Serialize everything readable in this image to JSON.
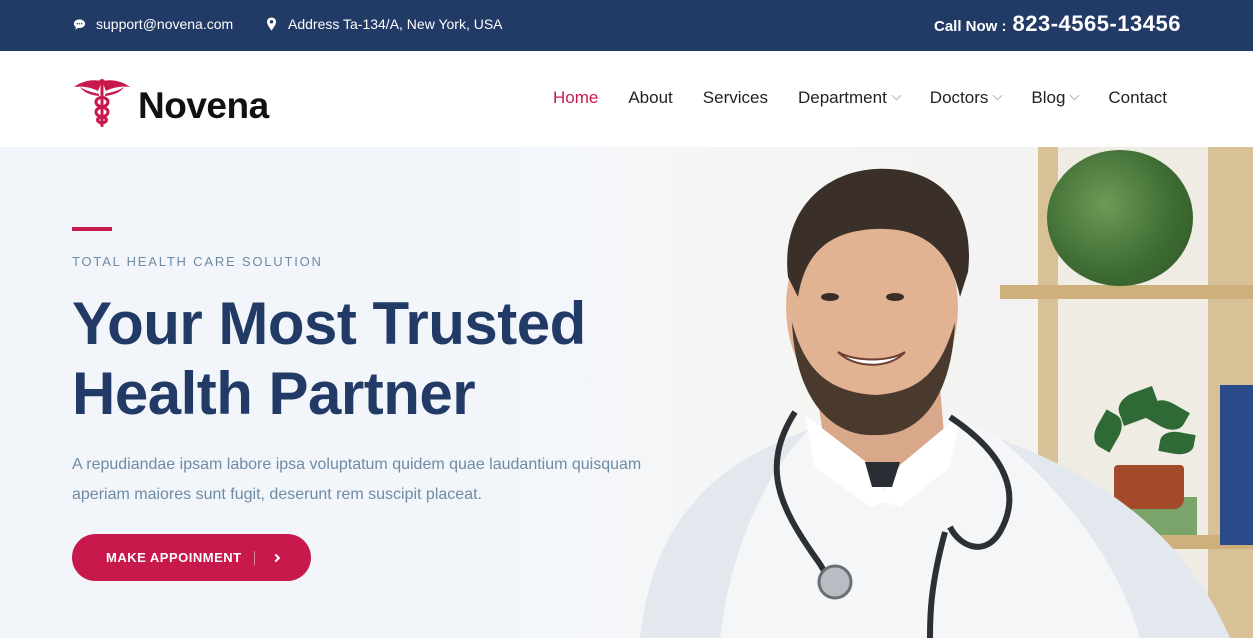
{
  "topbar": {
    "email": "support@novena.com",
    "email_icon": "chat-bubble-icon",
    "address": "Address Ta-134/A, New York, USA",
    "address_icon": "map-pin-icon",
    "call_label": "Call Now :",
    "call_number": "823-4565-13456"
  },
  "brand": {
    "name": "Novena",
    "logo_icon": "caduceus-icon",
    "accent": "#c8194c",
    "navy": "#223a66"
  },
  "nav": {
    "items": [
      {
        "label": "Home",
        "active": true,
        "dropdown": false
      },
      {
        "label": "About",
        "active": false,
        "dropdown": false
      },
      {
        "label": "Services",
        "active": false,
        "dropdown": false
      },
      {
        "label": "Department",
        "active": false,
        "dropdown": true
      },
      {
        "label": "Doctors",
        "active": false,
        "dropdown": true
      },
      {
        "label": "Blog",
        "active": false,
        "dropdown": true
      },
      {
        "label": "Contact",
        "active": false,
        "dropdown": false
      }
    ]
  },
  "hero": {
    "eyebrow": "TOTAL HEALTH CARE SOLUTION",
    "title_line1": "Your Most Trusted",
    "title_line2": "Health Partner",
    "description": "A repudiandae ipsam labore ipsa voluptatum quidem quae laudantium quisquam aperiam maiores sunt fugit, deserunt rem suscipit placeat.",
    "cta_label": "MAKE APPOINMENT"
  }
}
